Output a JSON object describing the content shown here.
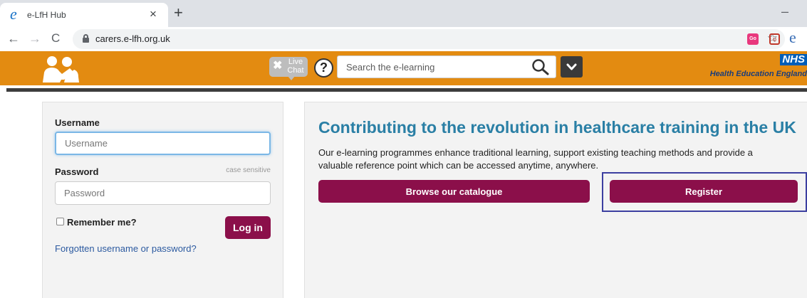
{
  "browser": {
    "tab_title": "e-LfH Hub",
    "tab_close": "×",
    "new_tab": "+",
    "minimize": "–",
    "favicon": "e",
    "url": "carers.e-lfh.org.uk",
    "back": "←",
    "forward": "→",
    "reload": "C",
    "star": "☆",
    "ext_go": "Go",
    "ext_pocket": "ʊ",
    "ext_edge": "e"
  },
  "header": {
    "livechat_text": "Live Chat",
    "livechat_close": "✖",
    "help": "?",
    "search_placeholder": "Search the e-learning",
    "nhs_mark": "NHS",
    "nhs_org": "Health Education England",
    "brand_color": "#e38b11"
  },
  "login": {
    "username_label": "Username",
    "username_placeholder": "Username",
    "password_label": "Password",
    "password_note": "case sensitive",
    "password_placeholder": "Password",
    "remember_label": "Remember me?",
    "login_button": "Log in",
    "forgot_link": "Forgotten username or password?"
  },
  "info": {
    "title": "Contributing to the revolution in healthcare training in the UK",
    "description": "Our e-learning programmes enhance traditional learning, support existing teaching methods and provide a valuable reference point which can be accessed anytime, anywhere.",
    "browse_button": "Browse our catalogue",
    "register_button": "Register",
    "button_color": "#8b0f4a"
  }
}
